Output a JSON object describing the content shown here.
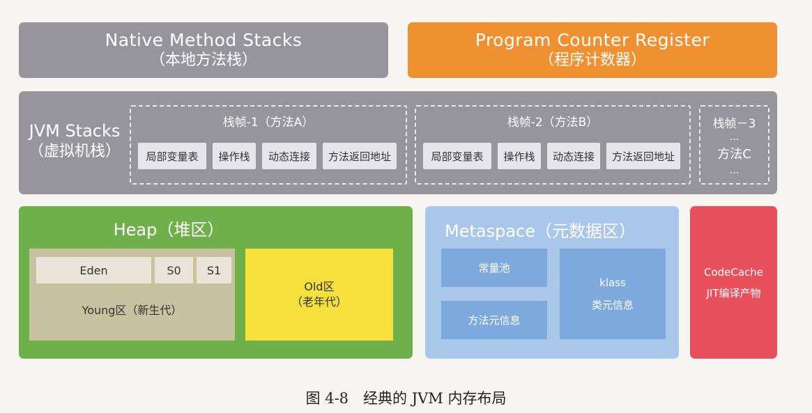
{
  "native": {
    "title": "Native Method Stacks",
    "subtitle": "（本地方法栈）"
  },
  "pc": {
    "title": "Program Counter Register",
    "subtitle": "（程序计数器）"
  },
  "jvm_stacks": {
    "title": "JVM Stacks",
    "subtitle": "（虚拟机栈）",
    "frames": [
      {
        "title": "栈帧-1（方法A）",
        "cells": [
          "局部变量表",
          "操作栈",
          "动态连接",
          "方法返回地址"
        ]
      },
      {
        "title": "栈帧-2（方法B）",
        "cells": [
          "局部变量表",
          "操作栈",
          "动态连接",
          "方法返回地址"
        ]
      },
      {
        "title": "栈帧－3",
        "dots1": "…",
        "method": "方法C",
        "dots2": "…"
      }
    ]
  },
  "heap": {
    "title": "Heap（堆区）",
    "eden": "Eden",
    "s0": "S0",
    "s1": "S1",
    "young": "Young区（新生代）",
    "old_line1": "Old区",
    "old_line2": "（老年代）"
  },
  "metaspace": {
    "title": "Metaspace（元数据区）",
    "constant_pool": "常量池",
    "method_info": "方法元信息",
    "klass_line1": "klass",
    "klass_line2": "类元信息"
  },
  "codecache": {
    "line1": "CodeCache",
    "line2": "JIT编译产物"
  },
  "caption": "图 4-8　经典的 JVM 内存布局",
  "colors": {
    "gray": "#96959c",
    "orange": "#ef9131",
    "green": "#70b04a",
    "young": "#c8c2a0",
    "old": "#f5e03c",
    "metaspace": "#a8c7e9",
    "metaspace_cell": "#7ea9dc",
    "codecache": "#e8505c"
  }
}
